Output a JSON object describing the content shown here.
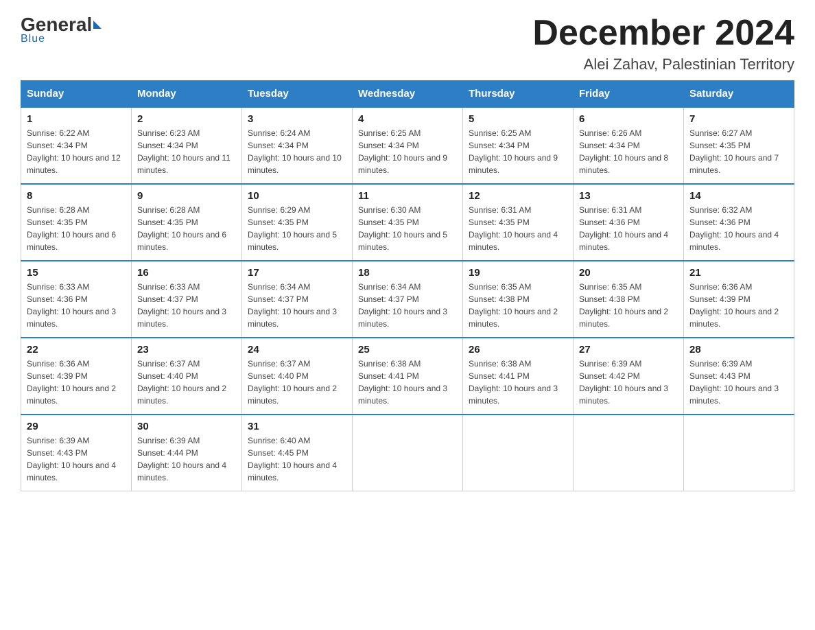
{
  "header": {
    "logo_general": "General",
    "logo_blue": "Blue",
    "month_title": "December 2024",
    "subtitle": "Alei Zahav, Palestinian Territory"
  },
  "days_of_week": [
    "Sunday",
    "Monday",
    "Tuesday",
    "Wednesday",
    "Thursday",
    "Friday",
    "Saturday"
  ],
  "weeks": [
    [
      {
        "day": "1",
        "sunrise": "6:22 AM",
        "sunset": "4:34 PM",
        "daylight": "10 hours and 12 minutes."
      },
      {
        "day": "2",
        "sunrise": "6:23 AM",
        "sunset": "4:34 PM",
        "daylight": "10 hours and 11 minutes."
      },
      {
        "day": "3",
        "sunrise": "6:24 AM",
        "sunset": "4:34 PM",
        "daylight": "10 hours and 10 minutes."
      },
      {
        "day": "4",
        "sunrise": "6:25 AM",
        "sunset": "4:34 PM",
        "daylight": "10 hours and 9 minutes."
      },
      {
        "day": "5",
        "sunrise": "6:25 AM",
        "sunset": "4:34 PM",
        "daylight": "10 hours and 9 minutes."
      },
      {
        "day": "6",
        "sunrise": "6:26 AM",
        "sunset": "4:34 PM",
        "daylight": "10 hours and 8 minutes."
      },
      {
        "day": "7",
        "sunrise": "6:27 AM",
        "sunset": "4:35 PM",
        "daylight": "10 hours and 7 minutes."
      }
    ],
    [
      {
        "day": "8",
        "sunrise": "6:28 AM",
        "sunset": "4:35 PM",
        "daylight": "10 hours and 6 minutes."
      },
      {
        "day": "9",
        "sunrise": "6:28 AM",
        "sunset": "4:35 PM",
        "daylight": "10 hours and 6 minutes."
      },
      {
        "day": "10",
        "sunrise": "6:29 AM",
        "sunset": "4:35 PM",
        "daylight": "10 hours and 5 minutes."
      },
      {
        "day": "11",
        "sunrise": "6:30 AM",
        "sunset": "4:35 PM",
        "daylight": "10 hours and 5 minutes."
      },
      {
        "day": "12",
        "sunrise": "6:31 AM",
        "sunset": "4:35 PM",
        "daylight": "10 hours and 4 minutes."
      },
      {
        "day": "13",
        "sunrise": "6:31 AM",
        "sunset": "4:36 PM",
        "daylight": "10 hours and 4 minutes."
      },
      {
        "day": "14",
        "sunrise": "6:32 AM",
        "sunset": "4:36 PM",
        "daylight": "10 hours and 4 minutes."
      }
    ],
    [
      {
        "day": "15",
        "sunrise": "6:33 AM",
        "sunset": "4:36 PM",
        "daylight": "10 hours and 3 minutes."
      },
      {
        "day": "16",
        "sunrise": "6:33 AM",
        "sunset": "4:37 PM",
        "daylight": "10 hours and 3 minutes."
      },
      {
        "day": "17",
        "sunrise": "6:34 AM",
        "sunset": "4:37 PM",
        "daylight": "10 hours and 3 minutes."
      },
      {
        "day": "18",
        "sunrise": "6:34 AM",
        "sunset": "4:37 PM",
        "daylight": "10 hours and 3 minutes."
      },
      {
        "day": "19",
        "sunrise": "6:35 AM",
        "sunset": "4:38 PM",
        "daylight": "10 hours and 2 minutes."
      },
      {
        "day": "20",
        "sunrise": "6:35 AM",
        "sunset": "4:38 PM",
        "daylight": "10 hours and 2 minutes."
      },
      {
        "day": "21",
        "sunrise": "6:36 AM",
        "sunset": "4:39 PM",
        "daylight": "10 hours and 2 minutes."
      }
    ],
    [
      {
        "day": "22",
        "sunrise": "6:36 AM",
        "sunset": "4:39 PM",
        "daylight": "10 hours and 2 minutes."
      },
      {
        "day": "23",
        "sunrise": "6:37 AM",
        "sunset": "4:40 PM",
        "daylight": "10 hours and 2 minutes."
      },
      {
        "day": "24",
        "sunrise": "6:37 AM",
        "sunset": "4:40 PM",
        "daylight": "10 hours and 2 minutes."
      },
      {
        "day": "25",
        "sunrise": "6:38 AM",
        "sunset": "4:41 PM",
        "daylight": "10 hours and 3 minutes."
      },
      {
        "day": "26",
        "sunrise": "6:38 AM",
        "sunset": "4:41 PM",
        "daylight": "10 hours and 3 minutes."
      },
      {
        "day": "27",
        "sunrise": "6:39 AM",
        "sunset": "4:42 PM",
        "daylight": "10 hours and 3 minutes."
      },
      {
        "day": "28",
        "sunrise": "6:39 AM",
        "sunset": "4:43 PM",
        "daylight": "10 hours and 3 minutes."
      }
    ],
    [
      {
        "day": "29",
        "sunrise": "6:39 AM",
        "sunset": "4:43 PM",
        "daylight": "10 hours and 4 minutes."
      },
      {
        "day": "30",
        "sunrise": "6:39 AM",
        "sunset": "4:44 PM",
        "daylight": "10 hours and 4 minutes."
      },
      {
        "day": "31",
        "sunrise": "6:40 AM",
        "sunset": "4:45 PM",
        "daylight": "10 hours and 4 minutes."
      },
      null,
      null,
      null,
      null
    ]
  ]
}
